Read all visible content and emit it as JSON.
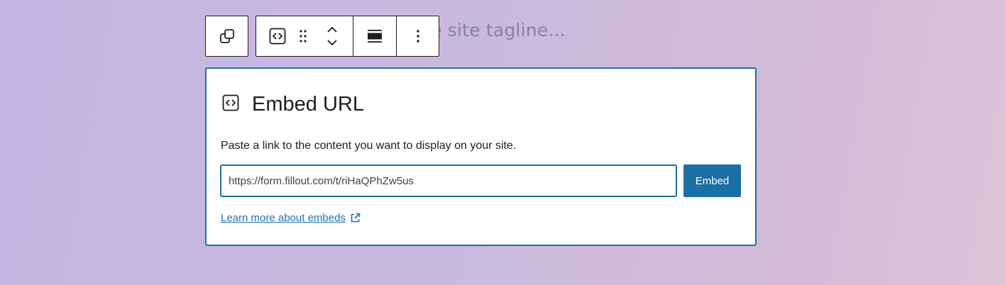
{
  "background": {
    "tagline_text": "e site tagline..."
  },
  "toolbar": {
    "transform_icon": "block-transform-icon",
    "embed_icon": "embed-code-icon",
    "drag_icon": "drag-handle-icon",
    "move_up_icon": "chevron-up-icon",
    "move_down_icon": "chevron-down-icon",
    "align_icon": "align-wide-icon",
    "options_icon": "more-vertical-icon"
  },
  "embed": {
    "icon": "embed-code-icon",
    "title": "Embed URL",
    "instructions": "Paste a link to the content you want to display on your site.",
    "input_value": "https://form.fillout.com/t/riHaQPhZw5us",
    "button_label": "Embed",
    "learn_more_label": "Learn more about embeds",
    "external_icon": "external-link-icon"
  },
  "colors": {
    "accent": "#1a6fa3",
    "link": "#2271b1",
    "text": "#1e1e1e"
  }
}
